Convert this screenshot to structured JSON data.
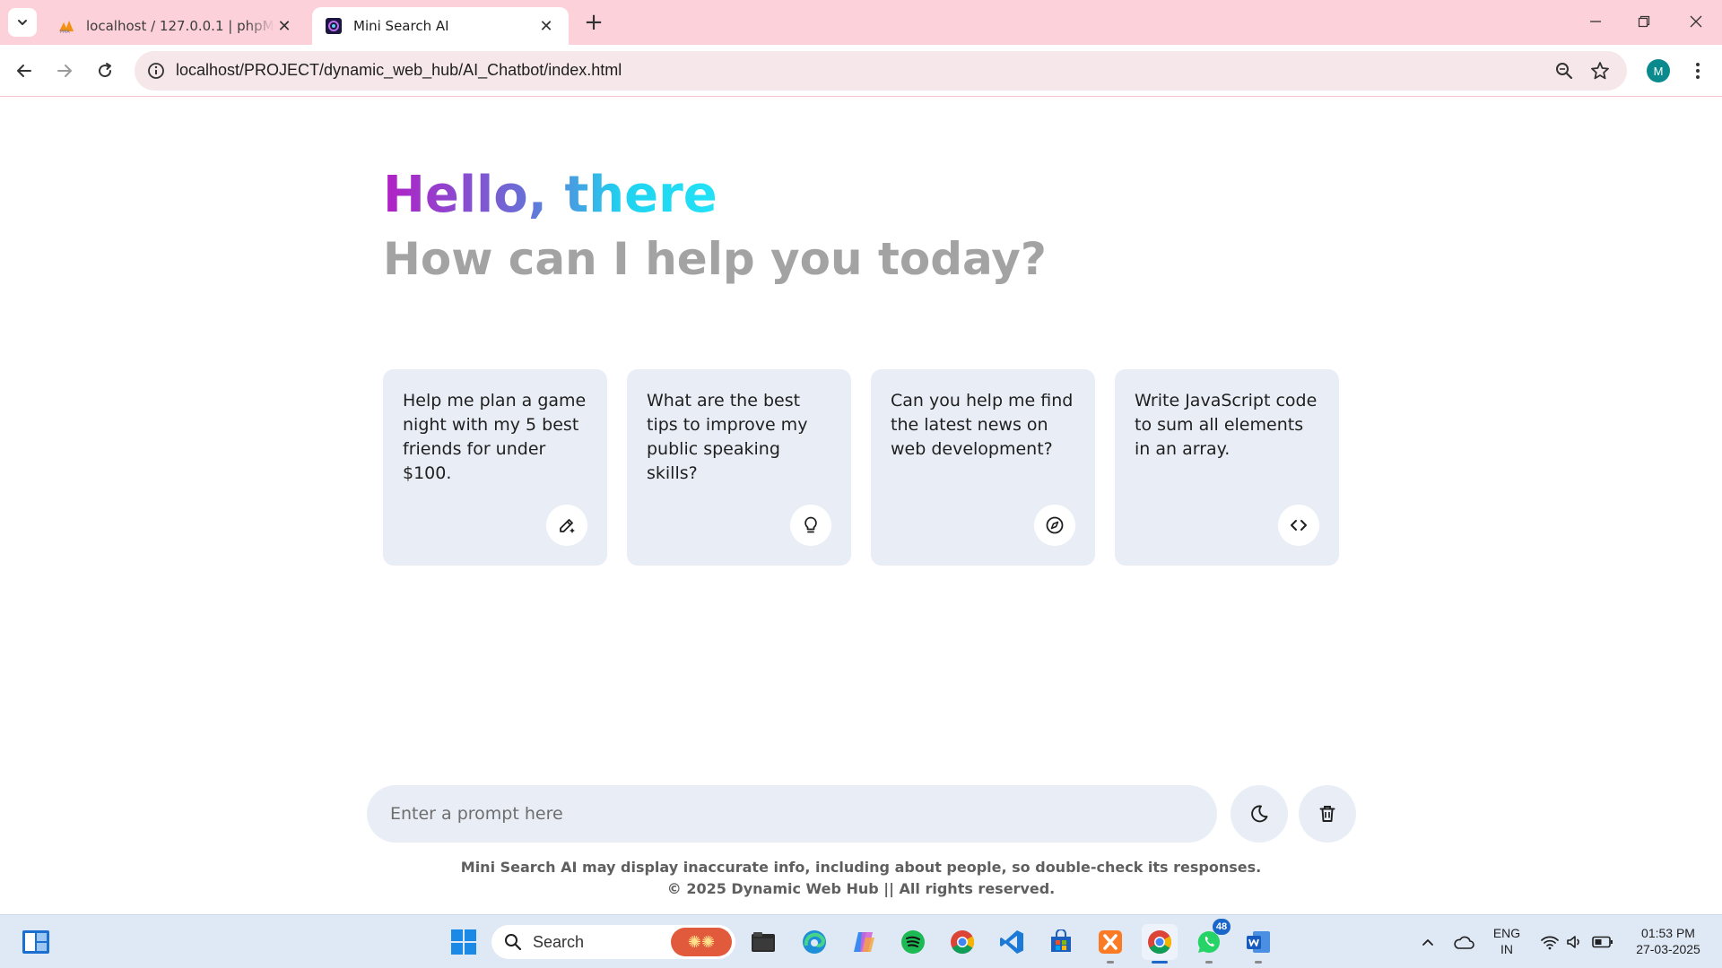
{
  "browser": {
    "tabs": [
      {
        "title": "localhost / 127.0.0.1 | phpMyAdmin",
        "favicon": "phpmyadmin-icon",
        "active": false
      },
      {
        "title": "Mini Search AI",
        "favicon": "mini-search-ai-icon",
        "active": true
      }
    ],
    "url": "localhost/PROJECT/dynamic_web_hub/AI_Chatbot/index.html",
    "profile_initial": "M",
    "accent_color": "#fcd1d9"
  },
  "page": {
    "greeting": "Hello, there",
    "subheading": "How can I help you today?",
    "suggestions": [
      {
        "text": "Help me plan a game night with my 5 best friends for under $100.",
        "icon": "pen-sparkle-icon"
      },
      {
        "text": "What are the best tips to improve my public speaking skills?",
        "icon": "lightbulb-icon"
      },
      {
        "text": "Can you help me find the latest news on web development?",
        "icon": "compass-icon"
      },
      {
        "text": "Write JavaScript code to sum all elements in an array.",
        "icon": "code-icon"
      }
    ],
    "prompt_placeholder": "Enter a prompt here",
    "theme_toggle_icon": "moon-icon",
    "delete_icon": "trash-icon",
    "disclaimer_line1": "Mini Search AI may display inaccurate info, including about people, so double-check its responses.",
    "disclaimer_line2": "© 2025 Dynamic Web Hub || All rights reserved.",
    "gradient_colors": [
      "#b31fc6",
      "#1fd3f0"
    ],
    "card_background": "#e9eef6"
  },
  "taskbar": {
    "search_label": "Search",
    "apps": [
      "file-explorer",
      "edge",
      "copilot",
      "spotify",
      "chrome",
      "vscode",
      "store",
      "xampp",
      "chrome-active",
      "whatsapp",
      "word"
    ],
    "whatsapp_badge": "48",
    "language_line1": "ENG",
    "language_line2": "IN",
    "time": "01:53 PM",
    "date": "27-03-2025"
  }
}
